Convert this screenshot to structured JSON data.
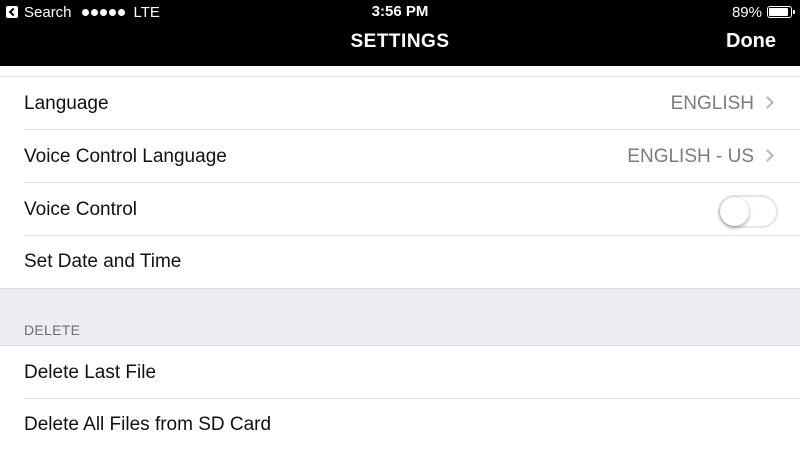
{
  "status_bar": {
    "back_app": "Search",
    "carrier": "LTE",
    "time": "3:56 PM",
    "battery": "89%",
    "battery_level": 0.89
  },
  "nav": {
    "title": "SETTINGS",
    "done_label": "Done"
  },
  "rows": [
    {
      "label": "Language",
      "value": "ENGLISH"
    },
    {
      "label": "Voice Control Language",
      "value": "ENGLISH - US"
    },
    {
      "label": "Voice Control",
      "toggle_on": false
    },
    {
      "label": "Set Date and Time"
    }
  ],
  "delete_section": {
    "header": "DELETE",
    "rows": [
      {
        "label": "Delete Last File"
      },
      {
        "label": "Delete All Files from SD Card"
      }
    ]
  },
  "colors": {
    "bar_bg": "#000000",
    "section_bg": "#ececf2",
    "value_gray": "#7c7c7c"
  }
}
